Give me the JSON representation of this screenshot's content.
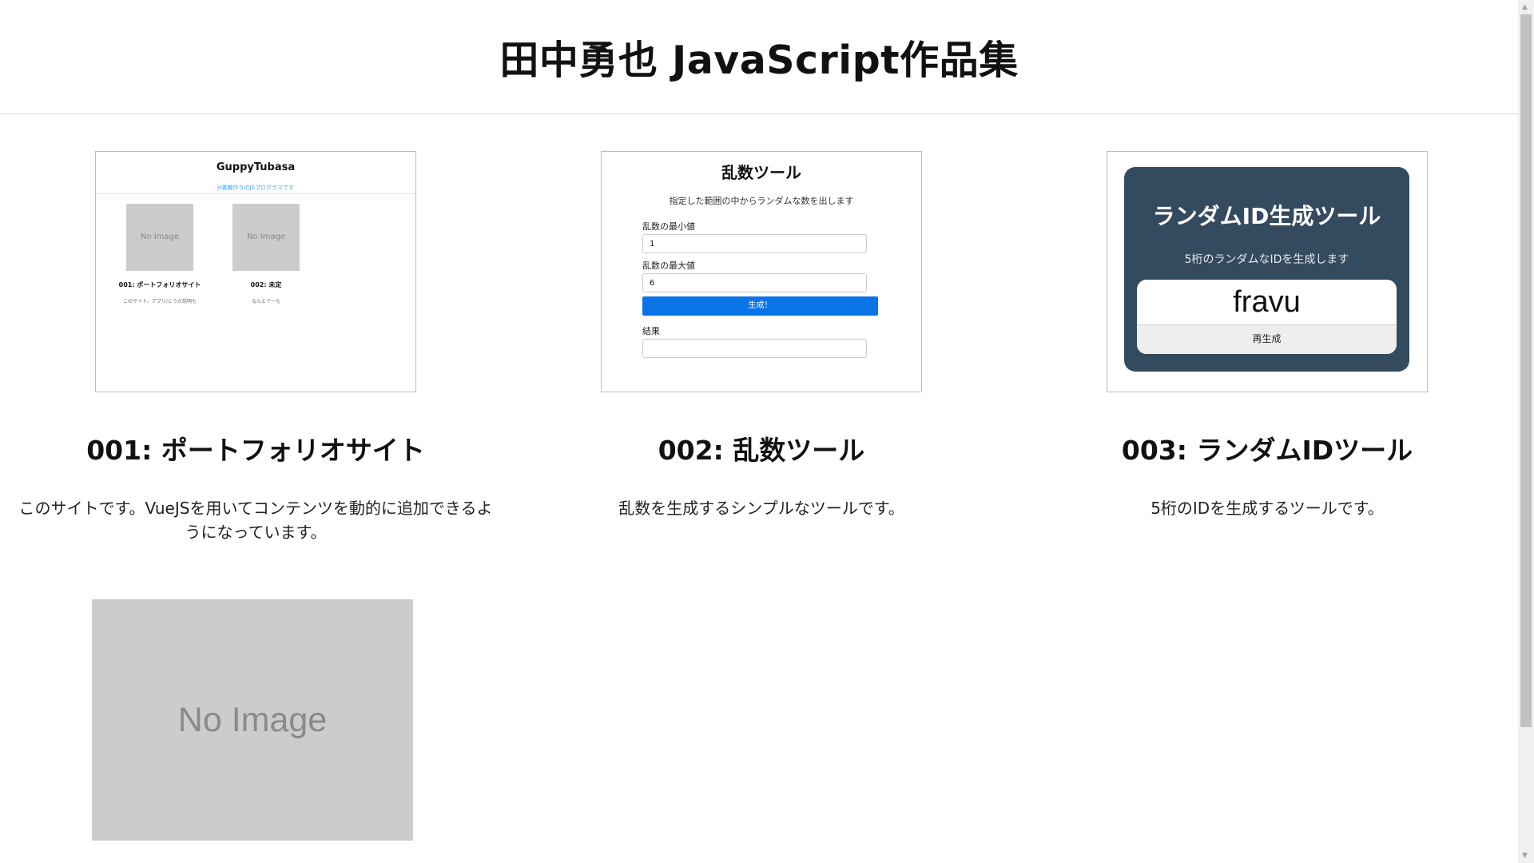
{
  "page": {
    "title": "田中勇也 JavaScript作品集"
  },
  "works": [
    {
      "title": "001: ポートフォリオサイト",
      "description": "このサイトです。VueJSを用いてコンテンツを動的に追加できるようになっています。",
      "preview": {
        "site_title": "GuppyTubasa",
        "subtitle": "js素敵作りのJSプログラマです",
        "items": [
          {
            "image_text": "No Image",
            "caption": "001: ポートフォリオサイト",
            "desc": "このサイト。アプリ/どうか説明も"
          },
          {
            "image_text": "No Image",
            "caption": "002: 未定",
            "desc": "なんとでーも"
          }
        ]
      }
    },
    {
      "title": "002: 乱数ツール",
      "description": "乱数を生成するシンプルなツールです。",
      "preview": {
        "title": "乱数ツール",
        "description": "指定した範囲の中からランダムな数を出します",
        "min_label": "乱数の最小値",
        "min_value": "1",
        "max_label": "乱数の最大値",
        "max_value": "6",
        "button": "生成！",
        "result_label": "結果",
        "result_value": ""
      }
    },
    {
      "title": "003: ランダムIDツール",
      "description": "5桁のIDを生成するツールです。",
      "preview": {
        "title": "ランダムID生成ツール",
        "description": "5桁のランダムなIDを生成します",
        "id_value": "fravu",
        "button": "再生成"
      }
    },
    {
      "title": "",
      "description": "",
      "preview": {
        "image_text": "No Image"
      }
    }
  ],
  "colors": {
    "accent_blue": "#0a74e6",
    "id_panel": "#344a5e",
    "placeholder_gray": "#cccccc"
  }
}
